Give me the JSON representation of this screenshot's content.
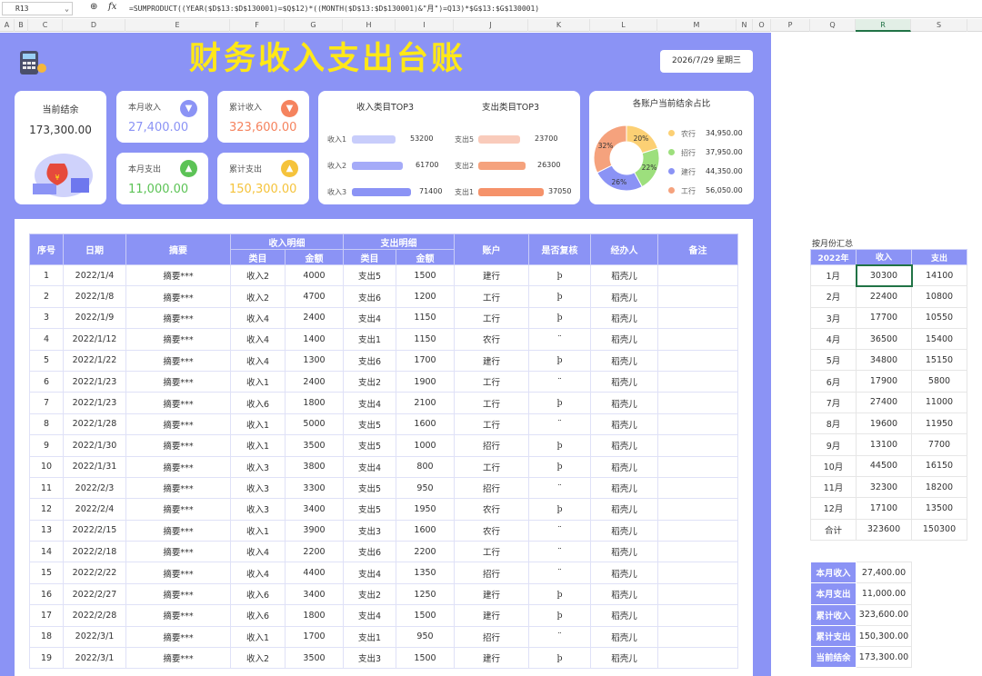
{
  "formula_bar": {
    "cell_ref": "R13",
    "formula": "=SUMPRODUCT((YEAR($D$13:$D$130001)=$Q$12)*((MONTH($D$13:$D$130001)&\"月\")=Q13)*$G$13:$G$130001)"
  },
  "columns": [
    "A",
    "B",
    "C",
    "D",
    "E",
    "F",
    "G",
    "H",
    "I",
    "J",
    "K",
    "L",
    "M",
    "N",
    "O",
    "P",
    "Q",
    "R",
    "S"
  ],
  "header": {
    "title": "财务收入支出台账",
    "date": "2026/7/29  星期三"
  },
  "cards": {
    "balance": {
      "label": "当前结余",
      "value": "173,300.00"
    },
    "month_income": {
      "label": "本月收入",
      "value": "27,400.00"
    },
    "total_income": {
      "label": "累计收入",
      "value": "323,600.00"
    },
    "month_expense": {
      "label": "本月支出",
      "value": "11,000.00"
    },
    "total_expense": {
      "label": "累计支出",
      "value": "150,300.00"
    }
  },
  "top3": {
    "income_title": "收入类目TOP3",
    "expense_title": "支出类目TOP3",
    "income": [
      {
        "name": "收入1",
        "value": "53200"
      },
      {
        "name": "收入2",
        "value": "61700"
      },
      {
        "name": "收入3",
        "value": "71400"
      }
    ],
    "expense": [
      {
        "name": "支出5",
        "value": "23700"
      },
      {
        "name": "支出2",
        "value": "26300"
      },
      {
        "name": "支出1",
        "value": "37050"
      }
    ]
  },
  "chart_data": {
    "type": "pie",
    "title": "各账户当前结余占比",
    "labels": [
      "农行",
      "招行",
      "建行",
      "工行"
    ],
    "values": [
      34950,
      37950,
      44350,
      56050
    ],
    "pcts": [
      "20%",
      "22%",
      "26%",
      "32%"
    ],
    "value_labels": [
      "34,950.00",
      "37,950.00",
      "44,350.00",
      "56,050.00"
    ],
    "colors": [
      "#fcd074",
      "#9ddf7d",
      "#8b93f5",
      "#f5a27d"
    ]
  },
  "table": {
    "h": {
      "seq": "序号",
      "date": "日期",
      "summary": "摘要",
      "income_detail": "收入明细",
      "expense_detail": "支出明细",
      "account": "账户",
      "reviewed": "是否复核",
      "handler": "经办人",
      "remark": "备注",
      "cat": "类目",
      "amt": "金额"
    },
    "rows": [
      [
        "1",
        "2022/1/4",
        "摘要***",
        "收入2",
        "4000",
        "支出5",
        "1500",
        "建行",
        "þ",
        "稻壳儿"
      ],
      [
        "2",
        "2022/1/8",
        "摘要***",
        "收入2",
        "4700",
        "支出6",
        "1200",
        "工行",
        "þ",
        "稻壳儿"
      ],
      [
        "3",
        "2022/1/9",
        "摘要***",
        "收入4",
        "2400",
        "支出4",
        "1150",
        "工行",
        "þ",
        "稻壳儿"
      ],
      [
        "4",
        "2022/1/12",
        "摘要***",
        "收入4",
        "1400",
        "支出1",
        "1150",
        "农行",
        "¨",
        "稻壳儿"
      ],
      [
        "5",
        "2022/1/22",
        "摘要***",
        "收入4",
        "1300",
        "支出6",
        "1700",
        "建行",
        "þ",
        "稻壳儿"
      ],
      [
        "6",
        "2022/1/23",
        "摘要***",
        "收入1",
        "2400",
        "支出2",
        "1900",
        "工行",
        "¨",
        "稻壳儿"
      ],
      [
        "7",
        "2022/1/23",
        "摘要***",
        "收入6",
        "1800",
        "支出4",
        "2100",
        "工行",
        "þ",
        "稻壳儿"
      ],
      [
        "8",
        "2022/1/28",
        "摘要***",
        "收入1",
        "5000",
        "支出5",
        "1600",
        "工行",
        "¨",
        "稻壳儿"
      ],
      [
        "9",
        "2022/1/30",
        "摘要***",
        "收入1",
        "3500",
        "支出5",
        "1000",
        "招行",
        "þ",
        "稻壳儿"
      ],
      [
        "10",
        "2022/1/31",
        "摘要***",
        "收入3",
        "3800",
        "支出4",
        "800",
        "工行",
        "þ",
        "稻壳儿"
      ],
      [
        "11",
        "2022/2/3",
        "摘要***",
        "收入3",
        "3300",
        "支出5",
        "950",
        "招行",
        "¨",
        "稻壳儿"
      ],
      [
        "12",
        "2022/2/4",
        "摘要***",
        "收入3",
        "3400",
        "支出5",
        "1950",
        "农行",
        "þ",
        "稻壳儿"
      ],
      [
        "13",
        "2022/2/15",
        "摘要***",
        "收入1",
        "3900",
        "支出3",
        "1600",
        "农行",
        "¨",
        "稻壳儿"
      ],
      [
        "14",
        "2022/2/18",
        "摘要***",
        "收入4",
        "2200",
        "支出6",
        "2200",
        "工行",
        "¨",
        "稻壳儿"
      ],
      [
        "15",
        "2022/2/22",
        "摘要***",
        "收入4",
        "4400",
        "支出4",
        "1350",
        "招行",
        "¨",
        "稻壳儿"
      ],
      [
        "16",
        "2022/2/27",
        "摘要***",
        "收入6",
        "3400",
        "支出2",
        "1250",
        "建行",
        "þ",
        "稻壳儿"
      ],
      [
        "17",
        "2022/2/28",
        "摘要***",
        "收入6",
        "1800",
        "支出4",
        "1500",
        "建行",
        "þ",
        "稻壳儿"
      ],
      [
        "18",
        "2022/3/1",
        "摘要***",
        "收入1",
        "1700",
        "支出1",
        "950",
        "招行",
        "¨",
        "稻壳儿"
      ],
      [
        "19",
        "2022/3/1",
        "摘要***",
        "收入2",
        "3500",
        "支出3",
        "1500",
        "建行",
        "þ",
        "稻壳儿"
      ]
    ]
  },
  "monthly": {
    "title": "按月份汇总",
    "headers": [
      "2022年",
      "收入",
      "支出"
    ],
    "rows": [
      [
        "1月",
        "30300",
        "14100"
      ],
      [
        "2月",
        "22400",
        "10800"
      ],
      [
        "3月",
        "17700",
        "10550"
      ],
      [
        "4月",
        "36500",
        "15400"
      ],
      [
        "5月",
        "34800",
        "15150"
      ],
      [
        "6月",
        "17900",
        "5800"
      ],
      [
        "7月",
        "27400",
        "11000"
      ],
      [
        "8月",
        "19600",
        "11950"
      ],
      [
        "9月",
        "13100",
        "7700"
      ],
      [
        "10月",
        "44500",
        "16150"
      ],
      [
        "11月",
        "32300",
        "18200"
      ],
      [
        "12月",
        "17100",
        "13500"
      ],
      [
        "合计",
        "323600",
        "150300"
      ]
    ]
  },
  "summary": [
    [
      "本月收入",
      "27,400.00"
    ],
    [
      "本月支出",
      "11,000.00"
    ],
    [
      "累计收入",
      "323,600.00"
    ],
    [
      "累计支出",
      "150,300.00"
    ],
    [
      "当前结余",
      "173,300.00"
    ]
  ]
}
